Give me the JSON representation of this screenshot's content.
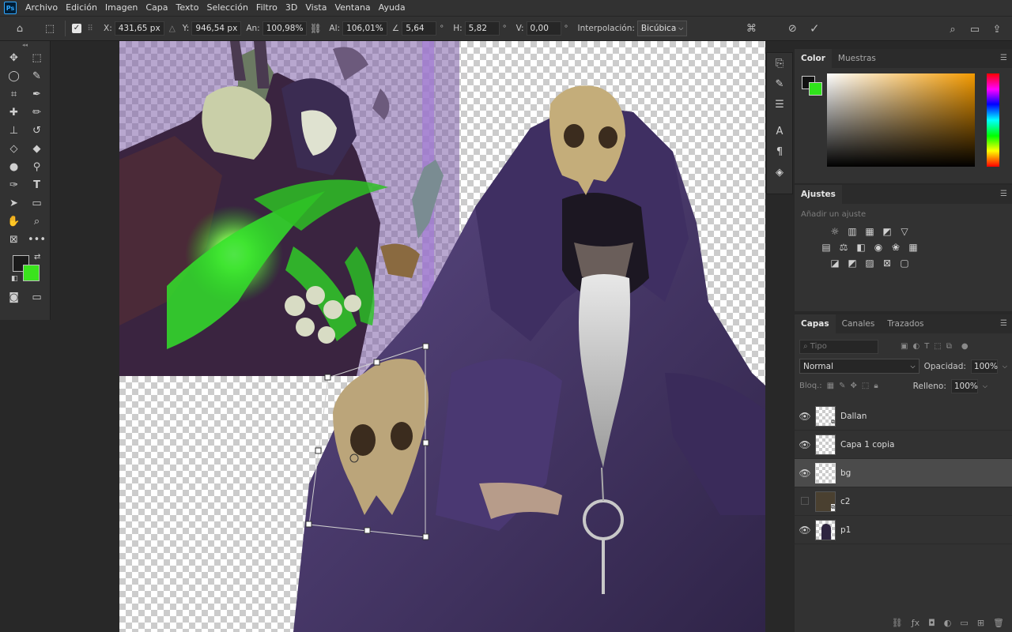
{
  "app": {
    "logo_text": "Ps"
  },
  "menu": [
    "Archivo",
    "Edición",
    "Imagen",
    "Capa",
    "Texto",
    "Selección",
    "Filtro",
    "3D",
    "Vista",
    "Ventana",
    "Ayuda"
  ],
  "options": {
    "x_label": "X:",
    "x_value": "431,65 px",
    "y_label": "Y:",
    "y_value": "946,54 px",
    "w_label": "An:",
    "w_value": "100,98%",
    "h_label": "Al:",
    "h_value": "106,01%",
    "angle_value": "5,64",
    "hskew_label": "H:",
    "hskew_value": "5,82",
    "vskew_label": "V:",
    "vskew_value": "0,00",
    "deg": "°",
    "interp_label": "Interpolación:",
    "interp_value": "Bicúbica"
  },
  "color_panel": {
    "tabs": [
      "Color",
      "Muestras"
    ]
  },
  "adjust_panel": {
    "tab": "Ajustes",
    "hint": "Añadir un ajuste"
  },
  "layers_panel": {
    "tabs": [
      "Capas",
      "Canales",
      "Trazados"
    ],
    "search_placeholder": "Tipo",
    "blend_mode": "Normal",
    "opacity_label": "Opacidad:",
    "opacity_value": "100%",
    "lock_label": "Bloq.:",
    "fill_label": "Relleno:",
    "fill_value": "100%",
    "layers": [
      {
        "name": "Dallan",
        "visible": true,
        "selected": false,
        "smart": true
      },
      {
        "name": "Capa 1 copia",
        "visible": true,
        "selected": false,
        "smart": false
      },
      {
        "name": "bg",
        "visible": true,
        "selected": true,
        "smart": false
      },
      {
        "name": "c2",
        "visible": false,
        "selected": false,
        "smart": true
      },
      {
        "name": "p1",
        "visible": true,
        "selected": false,
        "smart": false
      }
    ]
  },
  "colors": {
    "foreground": "#1a1a1a",
    "background": "#3ae31d"
  }
}
